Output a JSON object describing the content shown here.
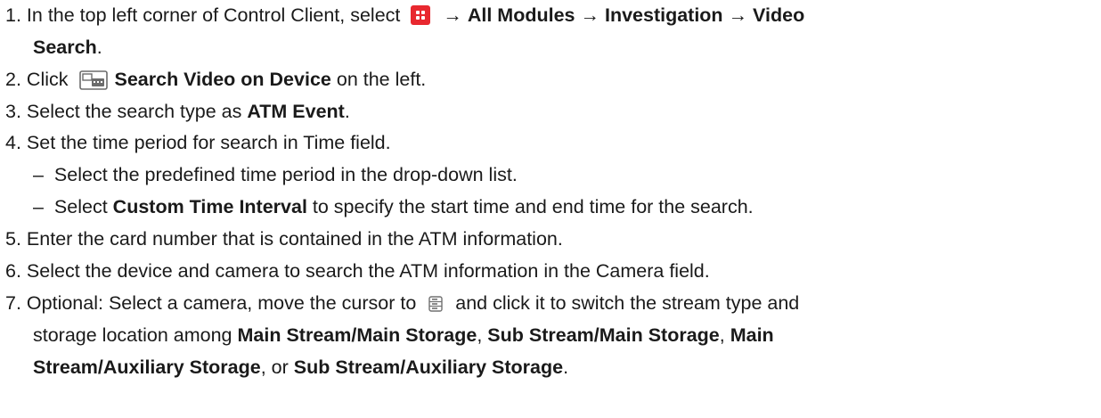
{
  "steps": [
    {
      "num": "1.",
      "a": "In the top left corner of Control Client, select",
      "arrow1": "→",
      "b1": "All Modules",
      "arrow2": "→",
      "b2": "Investigation",
      "arrow3": "→",
      "b3": "Video",
      "b3_cont": "Search",
      "end": "."
    },
    {
      "num": "2.",
      "a": "Click",
      "b": "Search Video on Device",
      "c": "on the left."
    },
    {
      "num": "3.",
      "a": "Select the search type as",
      "b": "ATM Event",
      "c": "."
    },
    {
      "num": "4.",
      "a": "Set the time period for search in Time field.",
      "sub": [
        {
          "dash": "–",
          "a": "Select the predefined time period in the drop-down list."
        },
        {
          "dash": "–",
          "a": "Select",
          "b": "Custom Time Interval",
          "c": "to specify the start time and end time for the search."
        }
      ]
    },
    {
      "num": "5.",
      "a": "Enter the card number that is contained in the ATM information."
    },
    {
      "num": "6.",
      "a": "Select the device and camera to search the ATM information in the Camera field."
    },
    {
      "num": "7.",
      "a": "Optional: Select a camera, move the cursor to",
      "a2": "and click it to switch the stream type and",
      "l2": "storage location among",
      "b1": "Main Stream/Main Storage",
      "s1": ",",
      "b2": "Sub Stream/Main Storage",
      "s2": ",",
      "b3": "Main",
      "b3_cont": "Stream/Auxiliary Storage",
      "s3": ", or",
      "b4": "Sub Stream/Auxiliary Storage",
      "end": "."
    }
  ],
  "icons": {
    "modules": "grid-menu-icon",
    "search_device": "video-search-device-icon",
    "storage": "storage-server-icon"
  },
  "colors": {
    "modules_icon": "#e8282f",
    "text": "#1a1a1a"
  }
}
